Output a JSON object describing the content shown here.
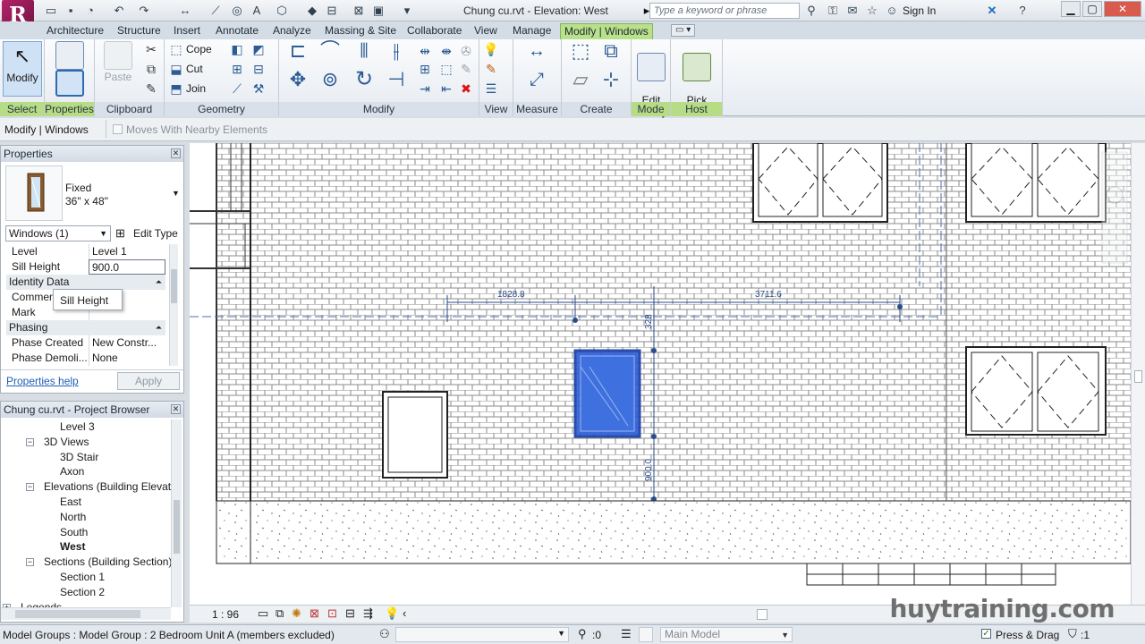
{
  "app": {
    "logo": "R",
    "title": "Chung cu.rvt - Elevation: West"
  },
  "search": {
    "placeholder": "Type a keyword or phrase"
  },
  "account": {
    "signin_label": "Sign In"
  },
  "ribbon_tabs": [
    "Architecture",
    "Structure",
    "Insert",
    "Annotate",
    "Analyze",
    "Massing & Site",
    "Collaborate",
    "View",
    "Manage",
    "Modify | Windows"
  ],
  "ribbon": {
    "select": {
      "modify_label": "Modify",
      "panel": "Select"
    },
    "properties": {
      "panel": "Properties"
    },
    "clipboard": {
      "paste_label": "Paste",
      "cope_label": "Cope",
      "cut_label": "Cut",
      "join_label": "Join",
      "panel": "Clipboard"
    },
    "geometry": {
      "panel": "Geometry"
    },
    "modify": {
      "panel": "Modify"
    },
    "view": {
      "panel": "View"
    },
    "measure": {
      "panel": "Measure"
    },
    "create": {
      "panel": "Create"
    },
    "mode": {
      "edit_family_label": "Edit\nFamily",
      "panel": "Mode"
    },
    "host": {
      "pick_host_label": "Pick\nNew Host",
      "panel": "Host"
    }
  },
  "options_bar": {
    "context": "Modify | Windows",
    "moves_with_nearby": "Moves With Nearby Elements"
  },
  "properties_palette": {
    "title": "Properties",
    "type_family": "Fixed",
    "type_size": "36\" x 48\"",
    "selector": "Windows (1)",
    "edit_type": "Edit Type",
    "rows": [
      {
        "key": "Level",
        "value": "Level 1"
      },
      {
        "key": "Sill Height",
        "value": "900.0"
      }
    ],
    "group_identity": "Identity Data",
    "identity_rows": [
      {
        "key": "Commen",
        "value": ""
      },
      {
        "key": "Mark",
        "value": ""
      }
    ],
    "group_phasing": "Phasing",
    "phasing_rows": [
      {
        "key": "Phase Created",
        "value": "New Constr..."
      },
      {
        "key": "Phase Demoli...",
        "value": "None"
      }
    ],
    "tooltip": "Sill Height",
    "help": "Properties help",
    "apply": "Apply"
  },
  "project_browser": {
    "title": "Chung cu.rvt - Project Browser",
    "items": [
      {
        "label": "Level 3",
        "level": 3
      },
      {
        "label": "3D Views",
        "level": 1,
        "toggle": "−"
      },
      {
        "label": "3D Stair",
        "level": 2
      },
      {
        "label": "Axon",
        "level": 2
      },
      {
        "label": "Elevations (Building Elevatio",
        "level": 1,
        "toggle": "−"
      },
      {
        "label": "East",
        "level": 2
      },
      {
        "label": "North",
        "level": 2
      },
      {
        "label": "South",
        "level": 2
      },
      {
        "label": "West",
        "level": 2,
        "bold": true
      },
      {
        "label": "Sections (Building Section)",
        "level": 1,
        "toggle": "−"
      },
      {
        "label": "Section 1",
        "level": 2
      },
      {
        "label": "Section 2",
        "level": 2
      },
      {
        "label": "Legends",
        "level": 0,
        "toggle": "+"
      }
    ]
  },
  "drawing": {
    "dim_top_left": "1828.8",
    "dim_top_right": "3711.6",
    "dim_vertical_top": "328",
    "dim_vertical_bottom": "900.0"
  },
  "view_bar": {
    "scale": "1 : 96"
  },
  "status_bar": {
    "message": "Model Groups : Model Group : 2 Bedroom Unit A (members excluded)",
    "zero": ":0",
    "model": "Main Model",
    "press_drag": "Press & Drag",
    "filter_count": ":1"
  },
  "watermark": "huytraining.com",
  "colors": {
    "context_tab": "#b9e08a",
    "selection_blue": "#2f5fd6",
    "dim_blue": "#2a4b8c"
  }
}
